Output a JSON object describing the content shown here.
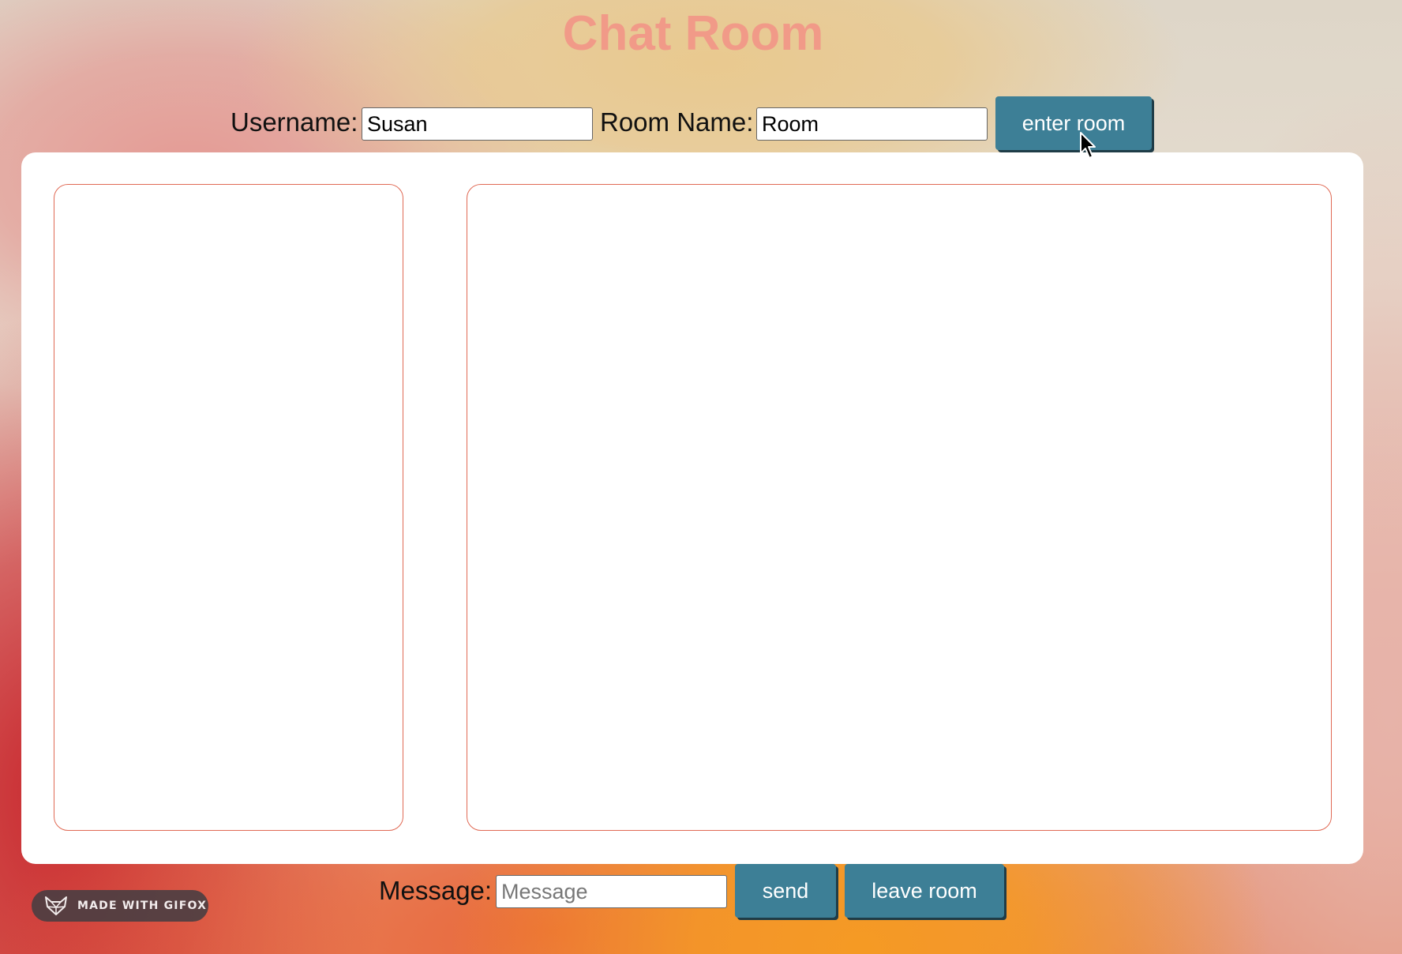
{
  "header": {
    "title": "Chat Room"
  },
  "login": {
    "username_label": "Username:",
    "username_value": "Susan",
    "room_label": "Room Name:",
    "room_value": "Room",
    "enter_button": "enter room"
  },
  "composer": {
    "message_label": "Message:",
    "message_placeholder": "Message",
    "send_button": "send",
    "leave_button": "leave room"
  },
  "badge": {
    "text": "MADE WITH GIFOX",
    "icon": "fox-logo-icon"
  },
  "colors": {
    "title": "#f19a88",
    "button": "#3d7f96",
    "panel_border": "#e06a55",
    "card": "#ffffff"
  }
}
